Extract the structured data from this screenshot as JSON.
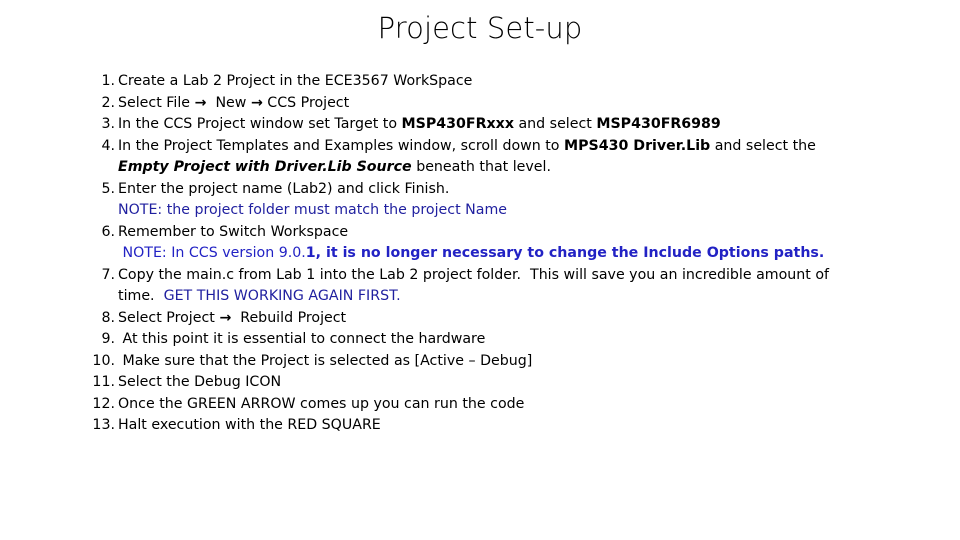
{
  "slide": {
    "title": "Project Set-up",
    "background_color": "#FFFFFF",
    "text_color": "#000000",
    "note_navy_color": "#1F1F9F",
    "note_blue_color": "#2222C4"
  },
  "steps": [
    {
      "number": "1.",
      "lines": [
        {
          "id": "s1l1",
          "text": "Create a Lab 2 Project in the ECE3567 WorkSpace"
        }
      ]
    },
    {
      "number": "2.",
      "lines": [
        {
          "id": "s2l1",
          "text": "Select File →  New → CCS Project"
        }
      ]
    },
    {
      "number": "3.",
      "lines": [
        {
          "id": "s3l1",
          "text": "In the CCS Project window set Target to MSP430FRxxx and select MSP430FR6989"
        }
      ]
    },
    {
      "number": "4.",
      "lines": [
        {
          "id": "s4l1",
          "text": "In the Project Templates and Examples window, scroll down to MPS430 Driver.Lib and select the"
        },
        {
          "id": "s4l2",
          "text": "Empty Project with Driver.Lib Source beneath that level."
        }
      ]
    },
    {
      "number": "5.",
      "lines": [
        {
          "id": "s5l1",
          "text": "Enter the project name (Lab2) and click Finish."
        },
        {
          "id": "s5l2",
          "text": "NOTE: the project folder must match the project Name"
        }
      ]
    },
    {
      "number": "6.",
      "lines": [
        {
          "id": "s6l1",
          "text": "Remember to Switch Workspace"
        },
        {
          "id": "s6l2",
          "text": " NOTE: In CCS version 9.0.1, it is no longer necessary to change the Include Options paths."
        }
      ]
    },
    {
      "number": "7.",
      "lines": [
        {
          "id": "s7l1",
          "text": "Copy the main.c from Lab 1 into the Lab 2 project folder.  This will save you an incredible amount of"
        },
        {
          "id": "s7l2",
          "text": "time.  GET THIS WORKING AGAIN FIRST."
        }
      ]
    },
    {
      "number": "8.",
      "lines": [
        {
          "id": "s8l1",
          "text": "Select Project →  Rebuild Project"
        }
      ]
    },
    {
      "number": "9.",
      "lines": [
        {
          "id": "s9l1",
          "text": " At this point it is essential to connect the hardware"
        }
      ]
    },
    {
      "number": "10.",
      "lines": [
        {
          "id": "s10l1",
          "text": " Make sure that the Project is selected as [Active – Debug]"
        }
      ]
    },
    {
      "number": "11.",
      "lines": [
        {
          "id": "s11l1",
          "text": "Select the Debug ICON"
        }
      ]
    },
    {
      "number": "12.",
      "lines": [
        {
          "id": "s12l1",
          "text": "Once the GREEN ARROW comes up you can run the code"
        }
      ]
    },
    {
      "number": "13.",
      "lines": [
        {
          "id": "s13l1",
          "text": "Halt execution with the RED SQUARE"
        }
      ]
    }
  ],
  "fragments": {
    "s2": {
      "pre": "Select File ",
      "arrow1": "→",
      "mid": "  New ",
      "arrow2": "→",
      "post": " CCS Project"
    },
    "s3": {
      "pre": "In the CCS Project window set Target to ",
      "bold1": "MSP430FRxxx",
      "mid": " and select ",
      "bold2": "MSP430FR6989"
    },
    "s4a": {
      "pre": "In the Project Templates and Examples window, scroll down to ",
      "bold1": "MPS430 Driver.Lib",
      "post": " and select the"
    },
    "s4b": {
      "bolditalic": "Empty Project with Driver.Lib Source",
      "post": " beneath that level."
    },
    "s6b": {
      "pre": " NOTE: In CCS version 9.0.",
      "bold": "1, it is no longer necessary to change the Include Options paths."
    },
    "s7b": {
      "pre": "time.  ",
      "blue": "GET THIS WORKING AGAIN FIRST."
    },
    "s8": {
      "pre": "Select Project ",
      "arrow": "→",
      "post": "  Rebuild Project"
    }
  }
}
